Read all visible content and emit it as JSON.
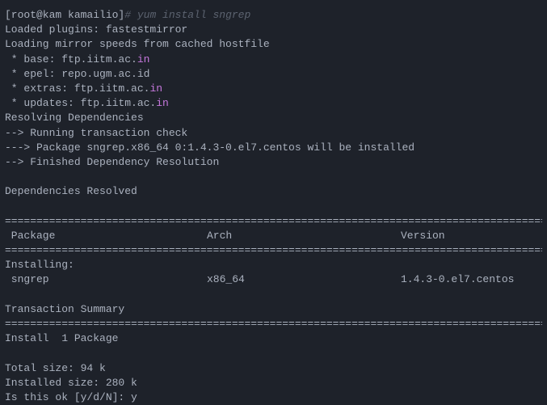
{
  "prompt": {
    "user_host": "[root@kam kamailio]",
    "hash": "#",
    "command": " yum install sngrep"
  },
  "loaded_plugins": "Loaded plugins: fastestmirror",
  "loading_mirror": "Loading mirror speeds from cached hostfile",
  "mirrors": {
    "base_prefix": " * base: ftp.iitm.ac.",
    "base_suffix": "in",
    "epel": " * epel: repo.ugm.ac.id",
    "extras_prefix": " * extras: ftp.iitm.ac.",
    "extras_suffix": "in",
    "updates_prefix": " * updates: ftp.iitm.ac.",
    "updates_suffix": "in"
  },
  "resolving": "Resolving Dependencies",
  "running_check": "--> Running transaction check",
  "pkg_install": "---> Package sngrep.x86_64 0:1.4.3-0.el7.centos will be installed",
  "finished_dep": "--> Finished Dependency Resolution",
  "deps_resolved": "Dependencies Resolved",
  "divider": "================================================================================================",
  "headers": {
    "package": " Package",
    "arch": "Arch",
    "version": "Version"
  },
  "installing_label": "Installing:",
  "row": {
    "name": " sngrep",
    "arch": "x86_64",
    "version": "1.4.3-0.el7.centos"
  },
  "transaction_summary": "Transaction Summary",
  "install_count": "Install  1 Package",
  "total_size": "Total size: 94 k",
  "installed_size": "Installed size: 280 k",
  "confirm": "Is this ok [y/d/N]: y"
}
